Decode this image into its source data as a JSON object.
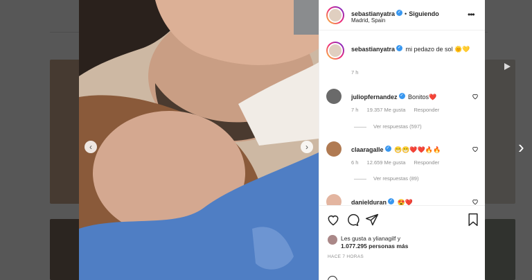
{
  "post": {
    "username": "sebastianyatra",
    "follow_status": "Siguiendo",
    "location": "Madrid, Spain",
    "caption": "mi pedazo de sol 🌞💛",
    "caption_time": "7 h"
  },
  "comments": [
    {
      "username": "juliopfernandez",
      "text": "Bonitos❤️",
      "time": "7 h",
      "likes": "19.357 Me gusta",
      "reply": "Responder",
      "view_replies": "Ver respuestas (597)"
    },
    {
      "username": "claaragalle",
      "text": "😁😁❤️❤️🔥🔥",
      "time": "6 h",
      "likes": "12.659 Me gusta",
      "reply": "Responder",
      "view_replies": "Ver respuestas (89)"
    },
    {
      "username": "danielduran",
      "text": "😍❤️"
    }
  ],
  "likes": {
    "line1": "Les gusta a ylianagilf y",
    "line2": "1.077.295 personas más"
  },
  "time_ago": "HACE 7 HORAS",
  "icons": {
    "like": "heart-outline-icon",
    "comment": "comment-bubble-icon",
    "share": "paper-plane-icon",
    "save": "bookmark-icon",
    "more": "more-dots-icon",
    "verified": "verified-badge-icon"
  },
  "colors": {
    "verified": "#3897f0",
    "text": "#262626",
    "muted": "#8e8e8e",
    "overlay": "rgba(0,0,0,0.65)"
  }
}
